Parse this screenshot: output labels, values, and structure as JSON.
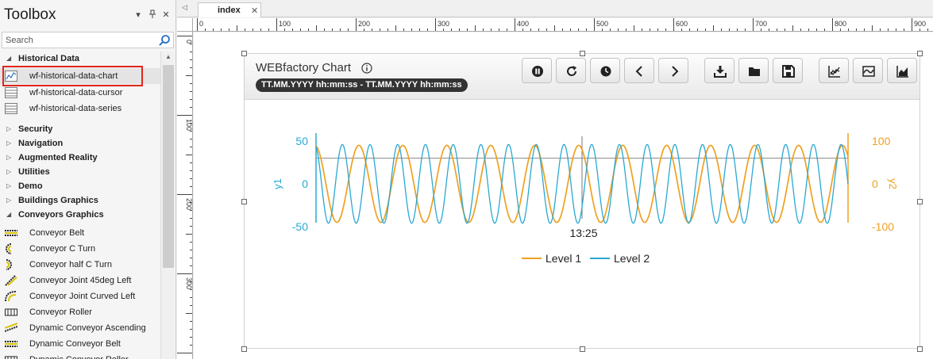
{
  "toolbox": {
    "title": "Toolbox",
    "pin_icon": "pin-icon",
    "dropdown_icon": "chevron-down-icon",
    "close_icon": "close-icon",
    "search": {
      "placeholder": "Search"
    },
    "categories": [
      {
        "label": "Historical Data",
        "expanded": true
      },
      {
        "label": "Security",
        "expanded": false
      },
      {
        "label": "Navigation",
        "expanded": false
      },
      {
        "label": "Augmented Reality",
        "expanded": false
      },
      {
        "label": "Utilities",
        "expanded": false
      },
      {
        "label": "Demo",
        "expanded": false
      },
      {
        "label": "Buildings Graphics",
        "expanded": false
      },
      {
        "label": "Conveyors Graphics",
        "expanded": true
      }
    ],
    "historical_items": [
      {
        "label": "wf-historical-data-chart",
        "icon": "chart-icon",
        "selected": true
      },
      {
        "label": "wf-historical-data-cursor",
        "icon": "table-icon"
      },
      {
        "label": "wf-historical-data-series",
        "icon": "table-icon"
      }
    ],
    "conveyor_items": [
      {
        "label": "Conveyor Belt",
        "icon": "conveyor-belt-icon"
      },
      {
        "label": "Conveyor C Turn",
        "icon": "conveyor-c-turn-icon"
      },
      {
        "label": "Conveyor half C Turn",
        "icon": "conveyor-half-c-turn-icon"
      },
      {
        "label": "Conveyor Joint 45deg Left",
        "icon": "conveyor-joint-icon"
      },
      {
        "label": "Conveyor Joint Curved Left",
        "icon": "conveyor-curved-icon"
      },
      {
        "label": "Conveyor Roller",
        "icon": "conveyor-roller-icon"
      },
      {
        "label": "Dynamic Conveyor Ascending",
        "icon": "conveyor-ascending-icon"
      },
      {
        "label": "Dynamic Conveyor Belt",
        "icon": "conveyor-belt-icon"
      },
      {
        "label": "Dynamic Conveyor Roller",
        "icon": "conveyor-roller-icon"
      }
    ]
  },
  "editor": {
    "tab": {
      "label": "index"
    },
    "ruler_h_labels": [
      "0",
      "100",
      "200",
      "300",
      "400",
      "500",
      "600",
      "700",
      "800",
      "900"
    ],
    "ruler_v_labels": [
      "0",
      "100",
      "200",
      "300"
    ]
  },
  "chart_widget": {
    "title": "WEBfactory Chart",
    "time_range": "TT.MM.YYYY hh:mm:ss - TT.MM.YYYY hh:mm:ss",
    "buttons": [
      {
        "name": "pause-button",
        "icon": "pause-icon"
      },
      {
        "name": "refresh-button",
        "icon": "refresh-icon"
      },
      {
        "name": "time-button",
        "icon": "clock-icon"
      },
      {
        "name": "previous-button",
        "icon": "chevron-left-icon"
      },
      {
        "name": "next-button",
        "icon": "chevron-right-icon"
      },
      {
        "name": "export-button",
        "icon": "download-icon"
      },
      {
        "name": "open-button",
        "icon": "folder-icon"
      },
      {
        "name": "save-button",
        "icon": "save-icon"
      },
      {
        "name": "chart-line-button",
        "icon": "chart-line-icon"
      },
      {
        "name": "chart-wave-button",
        "icon": "chart-wave-icon"
      },
      {
        "name": "chart-area-button",
        "icon": "chart-area-icon"
      }
    ]
  },
  "chart_data": {
    "type": "line",
    "title": "",
    "xlabel": "",
    "x_tick_labels": [
      "13:25"
    ],
    "y1": {
      "label": "y1",
      "ticks": [
        "50",
        "0",
        "-50"
      ],
      "range": [
        -50,
        50
      ],
      "color": "#29a8d3"
    },
    "y2": {
      "label": "y2",
      "ticks": [
        "100",
        "0",
        "-100"
      ],
      "range": [
        -100,
        100
      ],
      "color": "#f0a020"
    },
    "series": [
      {
        "name": "Level 1",
        "axis": "y2",
        "color": "#f0a020",
        "amplitude": 90,
        "cycles": 12.1
      },
      {
        "name": "Level 2",
        "axis": "y1",
        "color": "#29a8d3",
        "amplitude": 46,
        "cycles": 19.2
      }
    ],
    "cursor_line_y1": 30,
    "legend": {
      "placement": "bottom",
      "items": [
        "Level 1",
        "Level 2"
      ]
    },
    "grid": false
  }
}
